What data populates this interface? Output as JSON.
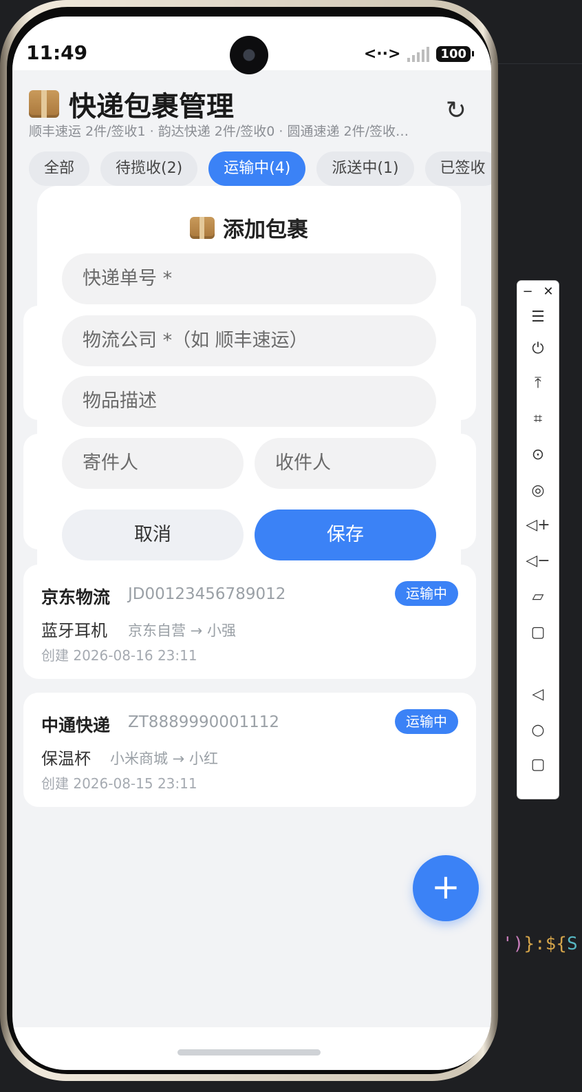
{
  "status_bar": {
    "time": "11:49",
    "battery": "100",
    "network": "<··>"
  },
  "header": {
    "title": "快递包裹管理",
    "subtitle": "顺丰速运 2件/签收1 · 韵达快递 2件/签收0 · 圆通速递 2件/签收…"
  },
  "tabs": [
    {
      "label": "全部",
      "active": false
    },
    {
      "label": "待揽收(2)",
      "active": false
    },
    {
      "label": "运输中(4)",
      "active": true
    },
    {
      "label": "派送中(1)",
      "active": false
    },
    {
      "label": "已签收",
      "active": false
    }
  ],
  "modal": {
    "title": "添加包裹",
    "fields": {
      "tracking_placeholder": "快递单号 *",
      "company_placeholder": "物流公司 *（如 顺丰速运）",
      "description_placeholder": "物品描述",
      "sender_placeholder": "寄件人",
      "receiver_placeholder": "收件人"
    },
    "cancel_label": "取消",
    "save_label": "保存"
  },
  "packages": [
    {
      "company": "京东物流",
      "tracking": "JD00123456789012",
      "status": "运输中",
      "item": "蓝牙耳机",
      "route": "京东自营 → 小强",
      "created": "创建 2026-08-16 23:11"
    },
    {
      "company": "中通快递",
      "tracking": "ZT8889990001112",
      "status": "运输中",
      "item": "保温杯",
      "route": "小米商城 → 小红",
      "created": "创建 2026-08-15 23:11"
    }
  ],
  "fab_label": "+",
  "ide_code": {
    "quote": "')",
    "rest": "}:${",
    "var": "S"
  },
  "colors": {
    "accent": "#3b82f6",
    "background": "#f2f3f5"
  },
  "toolbar": {
    "icons": [
      "menu-icon",
      "power-icon",
      "pin-top-icon",
      "crop-icon",
      "rotate-icon",
      "record-icon",
      "volume-up-icon",
      "volume-down-icon",
      "shake-icon",
      "multi-device-icon",
      "back-icon",
      "home-icon",
      "recents-icon"
    ]
  }
}
